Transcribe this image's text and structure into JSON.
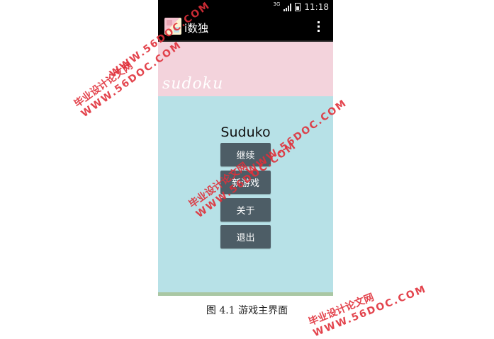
{
  "status_bar": {
    "network": "3G",
    "time": "11:18"
  },
  "action_bar": {
    "title": "i数独"
  },
  "banner": {
    "text": "sudoku"
  },
  "main": {
    "title": "Suduko",
    "buttons": [
      {
        "label": "继续"
      },
      {
        "label": "新游戏"
      },
      {
        "label": "关于"
      },
      {
        "label": "退出"
      }
    ]
  },
  "caption": "图 4.1  游戏主界面",
  "watermark": {
    "cn": "毕业设计论文网",
    "url": "WWW.56DOC.COM"
  },
  "colors": {
    "banner": "#f3d3dc",
    "background": "#b7e1e7",
    "button": "#4d5d66",
    "watermark": "#e0303a"
  }
}
